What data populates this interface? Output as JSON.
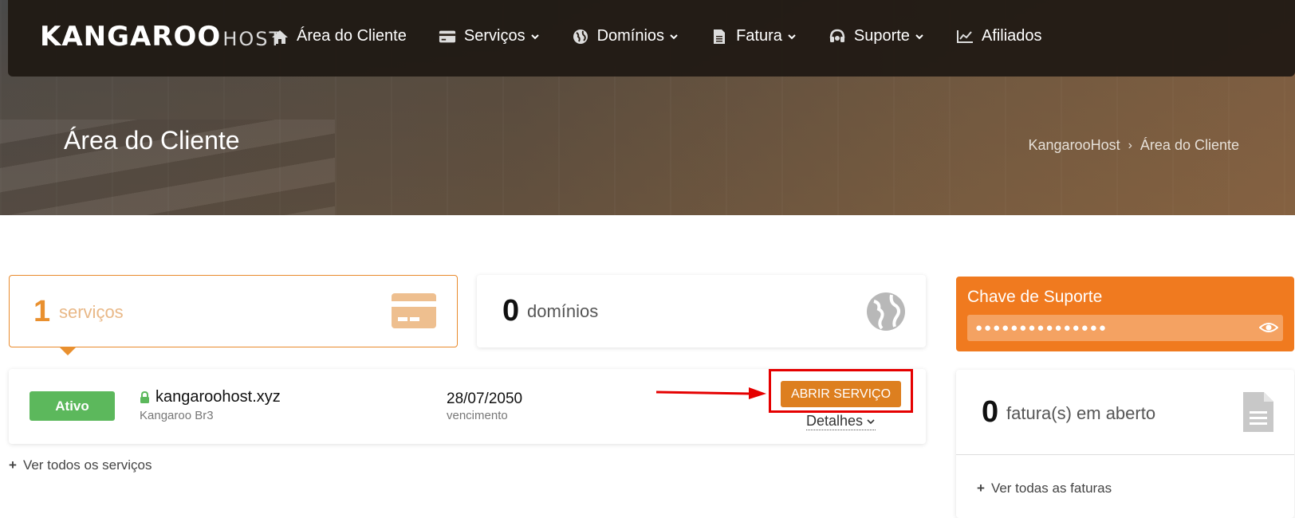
{
  "brand": {
    "logo_main": "KANGAROO",
    "logo_sub": "HOST"
  },
  "nav": {
    "items": [
      {
        "label": "Área do Cliente",
        "icon": "home-icon",
        "dropdown": false
      },
      {
        "label": "Serviços",
        "icon": "credit-card-icon",
        "dropdown": true
      },
      {
        "label": "Domínios",
        "icon": "globe-icon",
        "dropdown": true
      },
      {
        "label": "Fatura",
        "icon": "document-icon",
        "dropdown": true
      },
      {
        "label": "Suporte",
        "icon": "headset-icon",
        "dropdown": true
      },
      {
        "label": "Afiliados",
        "icon": "chart-line-icon",
        "dropdown": false
      }
    ]
  },
  "header": {
    "title": "Área do Cliente",
    "breadcrumb": [
      "KangarooHost",
      "Área do Cliente"
    ]
  },
  "stats": {
    "services": {
      "count": "1",
      "label": "serviços"
    },
    "domains": {
      "count": "0",
      "label": "domínios"
    }
  },
  "support_key": {
    "title": "Chave de Suporte",
    "masked_value": "●●●●●●●●●●●●●●●"
  },
  "service": {
    "status": "Ativo",
    "domain": "kangaroohost.xyz",
    "plan": "Kangaroo Br3",
    "due_date": "28/07/2050",
    "due_label": "vencimento",
    "open_button": "ABRIR SERVIÇO",
    "details_label": "Detalhes"
  },
  "links": {
    "all_services": "Ver todos os serviços",
    "all_invoices": "Ver todas as faturas"
  },
  "invoices": {
    "count": "0",
    "label": "fatura(s) em aberto"
  },
  "colors": {
    "accent": "#f07a1f",
    "button": "#dd7f1f",
    "active": "#5cb85c",
    "highlight": "#e50000"
  }
}
